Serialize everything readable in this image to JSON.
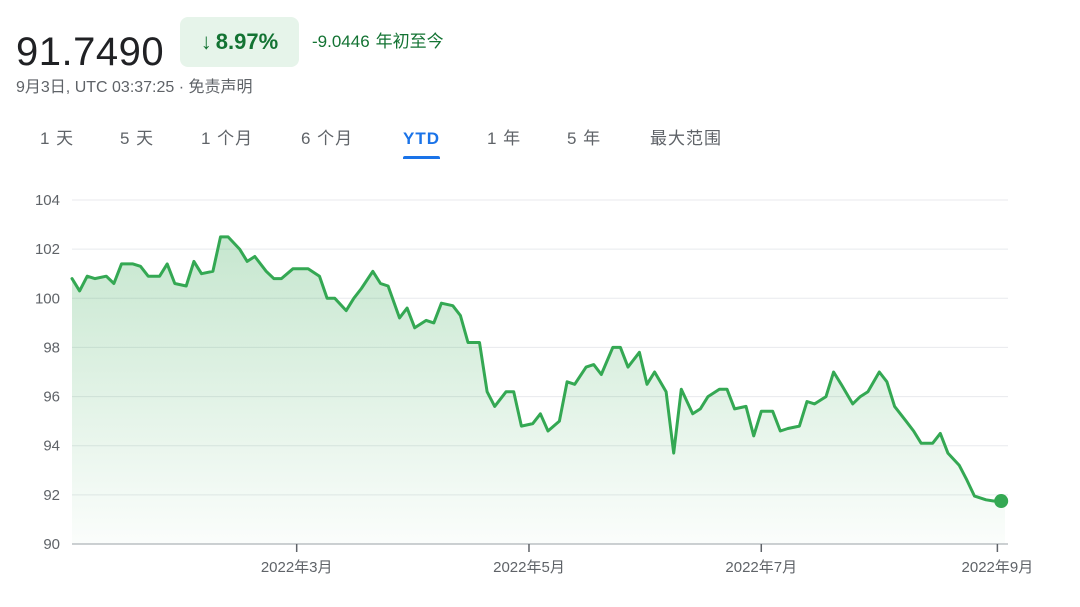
{
  "quote": {
    "price": "91.7490",
    "change_pct": "8.97%",
    "change_arrow_icon": "arrow-down-icon",
    "ytd_change": "-9.0446",
    "ytd_label": "年初至今",
    "timestamp": "9月3日, UTC 03:37:25 · 免责声明",
    "positive_color": "#137333",
    "badge_bg": "#e6f4ea"
  },
  "tabs": [
    {
      "label": "1 天"
    },
    {
      "label": "5 天"
    },
    {
      "label": "1 个月"
    },
    {
      "label": "6 个月"
    },
    {
      "label": "YTD",
      "active": true
    },
    {
      "label": "1 年"
    },
    {
      "label": "5 年"
    },
    {
      "label": "最大范围"
    }
  ],
  "chart_data": {
    "type": "area",
    "y_ticks": [
      "104",
      "102",
      "100",
      "98",
      "96",
      "94",
      "92",
      "90"
    ],
    "ylim": [
      90,
      104
    ],
    "x_ticks": [
      "2022年3月",
      "2022年5月",
      "2022年7月",
      "2022年9月"
    ],
    "x_tick_dates": [
      "2022-03-01",
      "2022-05-01",
      "2022-07-01",
      "2022-09-01"
    ],
    "xlim": [
      "2022-01-01",
      "2022-09-03"
    ],
    "grid": true,
    "line_color": "#34a853",
    "series": [
      {
        "x": [
          "2022-01-01",
          "2022-01-03",
          "2022-01-05",
          "2022-01-07",
          "2022-01-10",
          "2022-01-12",
          "2022-01-14",
          "2022-01-17",
          "2022-01-19",
          "2022-01-21",
          "2022-01-24",
          "2022-01-26",
          "2022-01-28",
          "2022-01-31",
          "2022-02-02",
          "2022-02-04",
          "2022-02-07",
          "2022-02-09",
          "2022-02-11",
          "2022-02-14",
          "2022-02-16",
          "2022-02-18",
          "2022-02-21",
          "2022-02-23",
          "2022-02-25",
          "2022-02-28",
          "2022-03-02",
          "2022-03-04",
          "2022-03-07",
          "2022-03-09",
          "2022-03-11",
          "2022-03-14",
          "2022-03-16",
          "2022-03-18",
          "2022-03-21",
          "2022-03-23",
          "2022-03-25",
          "2022-03-28",
          "2022-03-30",
          "2022-04-01",
          "2022-04-04",
          "2022-04-06",
          "2022-04-08",
          "2022-04-11",
          "2022-04-13",
          "2022-04-15",
          "2022-04-18",
          "2022-04-20",
          "2022-04-22",
          "2022-04-25",
          "2022-04-27",
          "2022-04-29",
          "2022-05-02",
          "2022-05-04",
          "2022-05-06",
          "2022-05-09",
          "2022-05-11",
          "2022-05-13",
          "2022-05-16",
          "2022-05-18",
          "2022-05-20",
          "2022-05-23",
          "2022-05-25",
          "2022-05-27",
          "2022-05-30",
          "2022-06-01",
          "2022-06-03",
          "2022-06-06",
          "2022-06-08",
          "2022-06-10",
          "2022-06-13",
          "2022-06-15",
          "2022-06-17",
          "2022-06-20",
          "2022-06-22",
          "2022-06-24",
          "2022-06-27",
          "2022-06-29",
          "2022-07-01",
          "2022-07-04",
          "2022-07-06",
          "2022-07-08",
          "2022-07-11",
          "2022-07-13",
          "2022-07-15",
          "2022-07-18",
          "2022-07-20",
          "2022-07-22",
          "2022-07-25",
          "2022-07-27",
          "2022-07-29",
          "2022-08-01",
          "2022-08-03",
          "2022-08-05",
          "2022-08-08",
          "2022-08-10",
          "2022-08-12",
          "2022-08-15",
          "2022-08-17",
          "2022-08-19",
          "2022-08-22",
          "2022-08-24",
          "2022-08-26",
          "2022-08-29",
          "2022-08-31",
          "2022-09-02",
          "2022-09-03"
        ],
        "values": [
          100.8,
          100.3,
          100.9,
          100.8,
          100.9,
          100.6,
          101.4,
          101.4,
          101.3,
          100.9,
          100.9,
          101.4,
          100.6,
          100.5,
          101.5,
          101.0,
          101.1,
          102.5,
          102.5,
          102.0,
          101.5,
          101.7,
          101.1,
          100.8,
          100.8,
          101.2,
          101.2,
          101.2,
          100.9,
          100.0,
          100.0,
          99.5,
          100.0,
          100.4,
          101.1,
          100.6,
          100.5,
          99.2,
          99.6,
          98.8,
          99.1,
          99.0,
          99.8,
          99.7,
          99.3,
          98.2,
          98.2,
          96.2,
          95.6,
          96.2,
          96.2,
          94.8,
          94.9,
          95.3,
          94.6,
          95.0,
          96.6,
          96.5,
          97.2,
          97.3,
          96.9,
          98.0,
          98.0,
          97.2,
          97.8,
          96.5,
          97.0,
          96.2,
          93.7,
          96.3,
          95.3,
          95.5,
          96.0,
          96.3,
          96.3,
          95.5,
          95.6,
          94.4,
          95.4,
          95.4,
          94.6,
          94.7,
          94.8,
          95.8,
          95.7,
          96.0,
          97.0,
          96.5,
          95.7,
          96.0,
          96.2,
          97.0,
          96.6,
          95.6,
          95.0,
          94.6,
          94.1,
          94.1,
          94.5,
          93.7,
          93.2,
          92.6,
          91.95,
          91.8,
          91.75,
          91.75,
          91.749
        ]
      }
    ],
    "last_point": {
      "x": "2022-09-02",
      "value": 91.749
    }
  }
}
